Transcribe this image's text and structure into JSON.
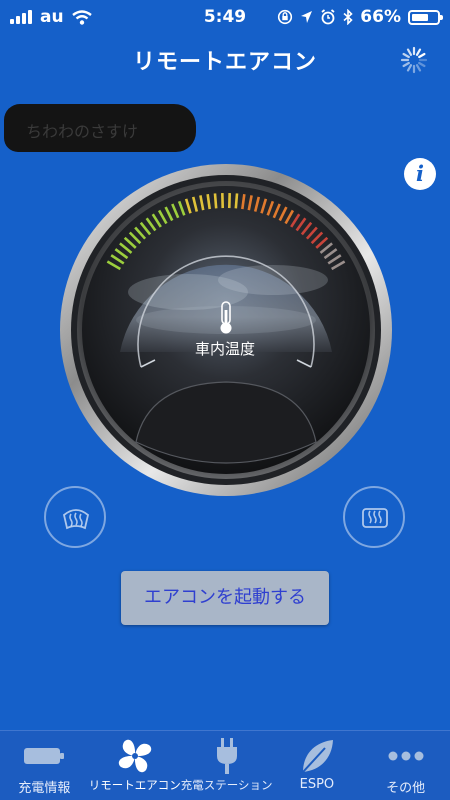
{
  "status_bar": {
    "carrier": "au",
    "time": "5:49",
    "battery_percent": "66%",
    "battery_level": 0.66
  },
  "header": {
    "title": "リモートエアコン"
  },
  "vehicle": {
    "name": "ちわわのさすけ"
  },
  "info_button": {
    "label": "i"
  },
  "gauge": {
    "label": "車内温度",
    "thermometer_icon": "thermometer-icon"
  },
  "controls": {
    "front_defroster_icon": "front-defroster-icon",
    "rear_defroster_icon": "rear-defroster-icon",
    "start_button_label": "エアコンを起動する"
  },
  "tab_bar": {
    "items": [
      {
        "label": "充電情報",
        "icon": "battery-icon",
        "active": false
      },
      {
        "label": "リモートエアコン",
        "icon": "fan-icon",
        "active": true
      },
      {
        "label": "充電ステーション",
        "icon": "plug-icon",
        "active": false
      },
      {
        "label": "ESPO",
        "icon": "leaf-icon",
        "active": false
      },
      {
        "label": "その他",
        "icon": "more-icon",
        "active": false
      }
    ]
  },
  "colors": {
    "background": "#1560c9",
    "button": "#a9b6c8",
    "button_text": "#2f3fd0"
  }
}
